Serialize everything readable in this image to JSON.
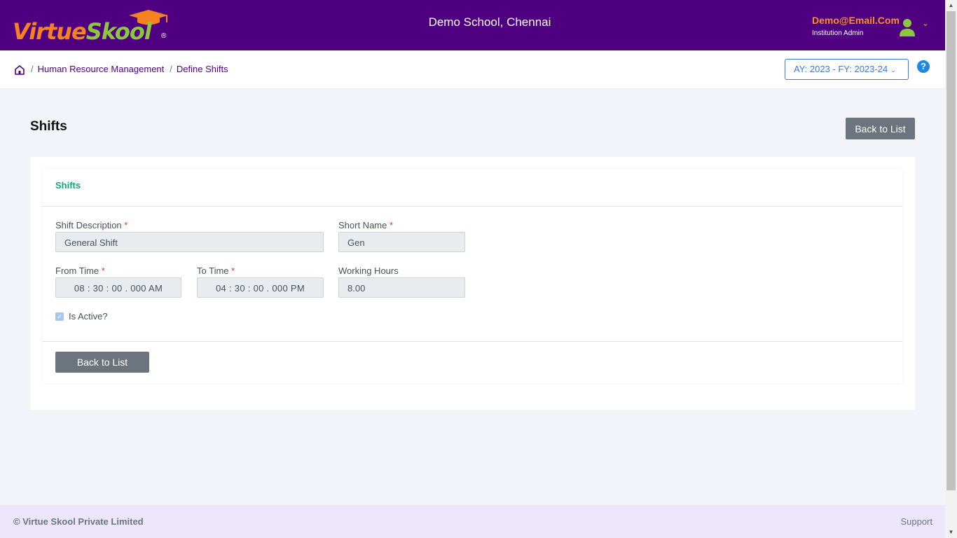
{
  "header": {
    "logo_text_1": "Virtue",
    "logo_text_2": "Skool",
    "logo_reg": "®",
    "school": "Demo School, Chennai",
    "user_email": "Demo@Email.Com",
    "user_role": "Institution Admin",
    "user_caret": "⌄"
  },
  "breadcrumb": {
    "sep": "/",
    "items": [
      "Human Resource Management",
      "Define Shifts"
    ]
  },
  "academic_year": {
    "label": "AY: 2023 - FY: 2023-24",
    "chevron": "⌄"
  },
  "help": {
    "glyph": "?"
  },
  "page": {
    "title": "Shifts",
    "back_button": "Back to List"
  },
  "form": {
    "card_title": "Shifts",
    "required_mark": "*",
    "shift_description": {
      "label": "Shift Description",
      "value": "General Shift"
    },
    "short_name": {
      "label": "Short Name",
      "value": "Gen"
    },
    "from_time": {
      "label": "From Time",
      "value": "08 : 30 : 00 . 000   AM"
    },
    "to_time": {
      "label": "To Time",
      "value": "04 : 30 : 00 . 000   PM"
    },
    "working_hours": {
      "label": "Working Hours",
      "value": "8.00"
    },
    "is_active": {
      "label": "Is Active?",
      "checked": true,
      "check_glyph": "✓"
    },
    "back_button": "Back to List"
  },
  "footer": {
    "copyright": "© Virtue Skool Private Limited",
    "support": "Support"
  },
  "colors": {
    "header_bg": "#4e0080",
    "accent_orange": "#f58220",
    "accent_green": "#8dc63f",
    "card_title": "#1aa37a",
    "button_gray": "#6c757d",
    "link_blue": "#3a7bd5"
  }
}
